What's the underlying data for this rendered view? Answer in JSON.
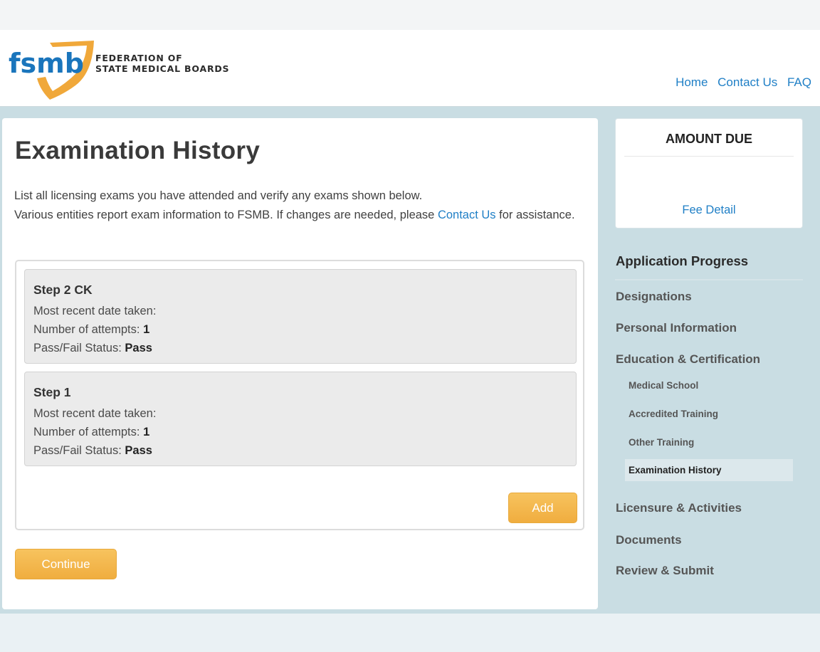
{
  "header": {
    "logo_text": "fsmb",
    "org_line1": "FEDERATION OF",
    "org_line2": "STATE MEDICAL BOARDS",
    "nav": [
      "Home",
      "Contact Us",
      "FAQ"
    ]
  },
  "main": {
    "title": "Examination History",
    "intro_line1": "List all licensing exams you have attended and verify any exams shown below.",
    "intro_line2_pre": "Various entities report exam information to FSMB. If changes are needed, please ",
    "intro_link": "Contact Us",
    "intro_line2_post": " for assistance.",
    "exams": [
      {
        "name": "Step 2 CK",
        "date_label": "Most recent date taken:",
        "date_value": "",
        "attempts_label": "Number of attempts:",
        "attempts_value": "1",
        "status_label": "Pass/Fail Status:",
        "status_value": "Pass"
      },
      {
        "name": "Step 1",
        "date_label": "Most recent date taken:",
        "date_value": "",
        "attempts_label": "Number of attempts:",
        "attempts_value": "1",
        "status_label": "Pass/Fail Status:",
        "status_value": "Pass"
      }
    ],
    "add_label": "Add",
    "continue_label": "Continue"
  },
  "sidebar": {
    "amount_title": "AMOUNT DUE",
    "fee_link": "Fee Detail",
    "progress_title": "Application Progress",
    "steps": [
      "Designations",
      "Personal Information",
      "Education & Certification",
      "Licensure & Activities",
      "Documents",
      "Review & Submit"
    ],
    "substeps": [
      "Medical School",
      "Accredited Training",
      "Other Training",
      "Examination History"
    ]
  },
  "colors": {
    "accent_orange": "#f0ad3f",
    "link_blue": "#1f7fc6",
    "band_blue": "#c9dde3"
  }
}
